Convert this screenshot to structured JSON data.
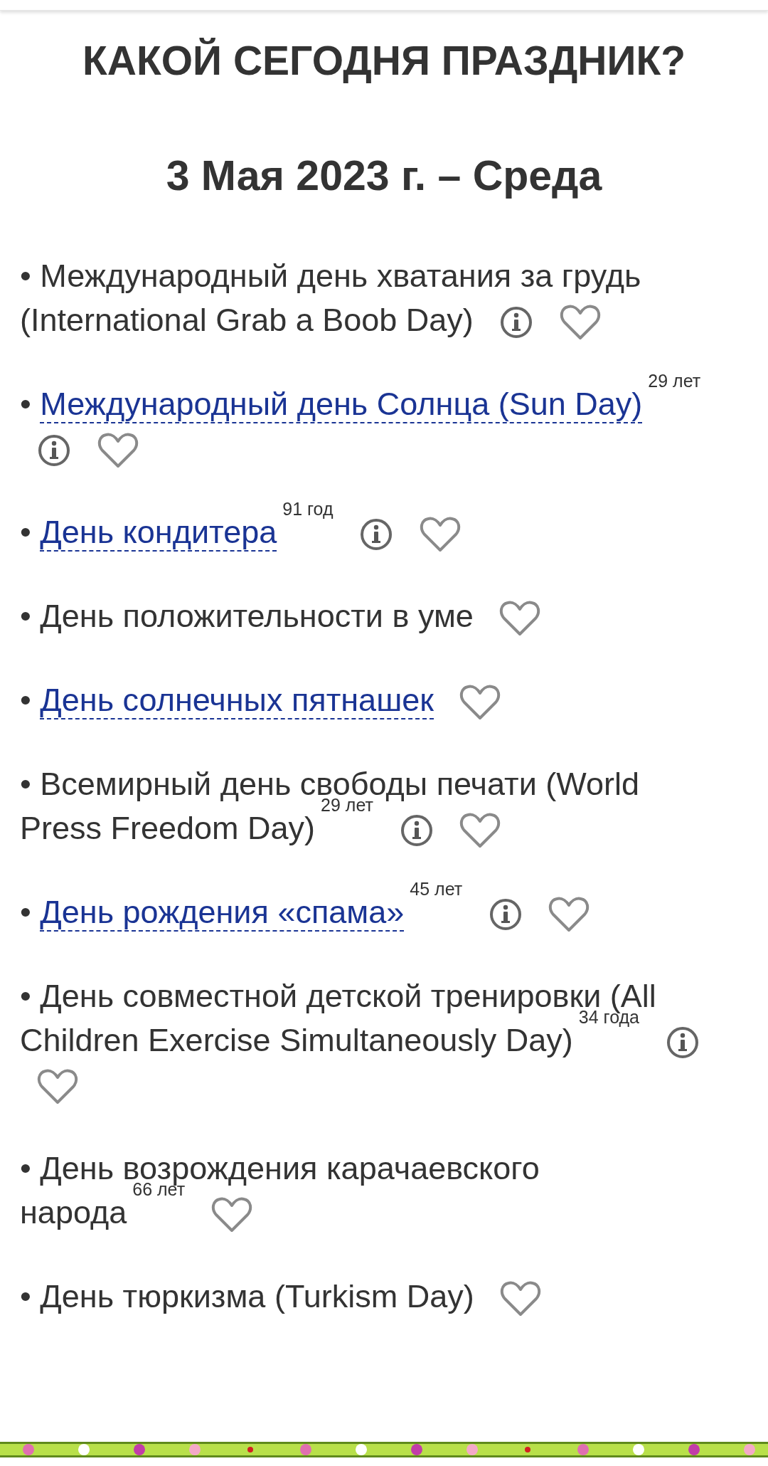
{
  "title": "КАКОЙ СЕГОДНЯ ПРАЗДНИК?",
  "date": "3 Мая 2023 г. – Среда",
  "holidays": [
    {
      "bullet": "•",
      "kind": "text",
      "lines": [
        "Международный день хватания за грудь",
        "(International Grab a Boob Day)"
      ],
      "info": true
    },
    {
      "bullet": "•",
      "kind": "link",
      "lines": [
        "Международный день Солнца (Sun Day)"
      ],
      "age": "29 лет",
      "info": true
    },
    {
      "bullet": "•",
      "kind": "link",
      "lines": [
        "День кондитера"
      ],
      "age": "91 год",
      "info": true
    },
    {
      "bullet": "•",
      "kind": "text",
      "lines": [
        "День положительности в уме"
      ],
      "info": false
    },
    {
      "bullet": "•",
      "kind": "link",
      "lines": [
        "День солнечных пятнашек"
      ],
      "info": false
    },
    {
      "bullet": "•",
      "kind": "text",
      "lines": [
        "Всемирный день свободы печати (World",
        "Press Freedom Day)"
      ],
      "age": "29 лет",
      "info": true
    },
    {
      "bullet": "•",
      "kind": "link",
      "lines": [
        "День рождения «спама»"
      ],
      "age": "45 лет",
      "info": true
    },
    {
      "bullet": "•",
      "kind": "text",
      "lines": [
        "День совместной детской тренировки (All",
        "Children Exercise Simultaneously Day)"
      ],
      "age": "34 года",
      "info": true
    },
    {
      "bullet": "•",
      "kind": "text",
      "lines": [
        "День возрождения карачаевского",
        "народа"
      ],
      "age": "66 лет",
      "info": false
    },
    {
      "bullet": "•",
      "kind": "text",
      "lines": [
        "День тюркизма (Turkism Day)"
      ],
      "info": false
    }
  ]
}
